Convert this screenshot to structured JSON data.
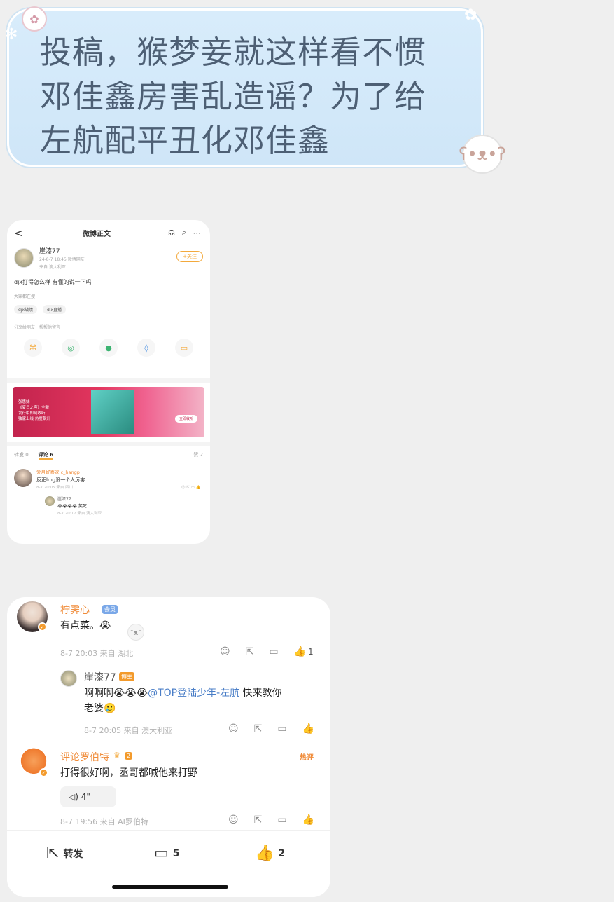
{
  "title_bubble": {
    "line1": "投稿，猴梦妾就这样看不惯",
    "line2": "邓佳鑫房害乱造谣？为了给",
    "line3": "左航配平丑化邓佳鑫"
  },
  "shot1": {
    "nav_back": "<",
    "nav_title": "微博正文",
    "nav_icons": [
      "headphone-icon",
      "search-icon",
      "more-icon"
    ],
    "user_name": "崖漆77",
    "user_meta": "24-8-7 18:45 微博网友",
    "user_meta2": "来自 澳大利亚",
    "follow_label": "+关注",
    "post_text": "djx打得怎么样 有懂的说一下吗",
    "sub_label": "大家都在搜",
    "tags": [
      "djx战绩",
      "djx直播"
    ],
    "hint": "分享给朋友，帮帮他留言",
    "banner_lines": [
      "张惠妹",
      "《夏日之声》全新",
      "发行中即刻收听",
      "独家上线 热度飙升"
    ],
    "banner_button": "立即收听",
    "tabs": {
      "repost": "转发 0",
      "comments": "评论 6",
      "likes": "赞 2"
    },
    "comment1_name": "爱月好喜欢 c_hangp",
    "comment1_text": "反正lmg没一个人厉害",
    "comment1_meta": "8-7 20:05 来自 四川",
    "comment1_likes": "1",
    "reply_name": "崖漆77",
    "reply_text": "😭😭😭😭 笑死",
    "reply_meta": "8-7 20:17 来自 澳大利亚"
  },
  "shot2": {
    "comment1": {
      "name": "柠霁心",
      "badge": "会员",
      "text": "有点菜。😭",
      "meta": "8-7 20:03 来自 湖北",
      "likes": "1"
    },
    "reply": {
      "name": "崖漆77",
      "badge": "博主",
      "text_prefix": "啊啊啊😭😭😭",
      "mention": "@TOP登陆少年-左航",
      "text_suffix": " 快来教你",
      "text_line2": "老婆🥲",
      "meta": "8-7 20:05 来自 澳大利亚"
    },
    "comment2": {
      "name": "评论罗伯特",
      "badge": "2",
      "hot": "热评",
      "text": "打得很好啊，丞哥都喊他来打野",
      "voice": "4\"",
      "meta": "8-7 19:56 来自 AI罗伯特"
    },
    "bottom": {
      "repost_label": "转发",
      "comment_count": "5",
      "like_count": "2"
    }
  }
}
